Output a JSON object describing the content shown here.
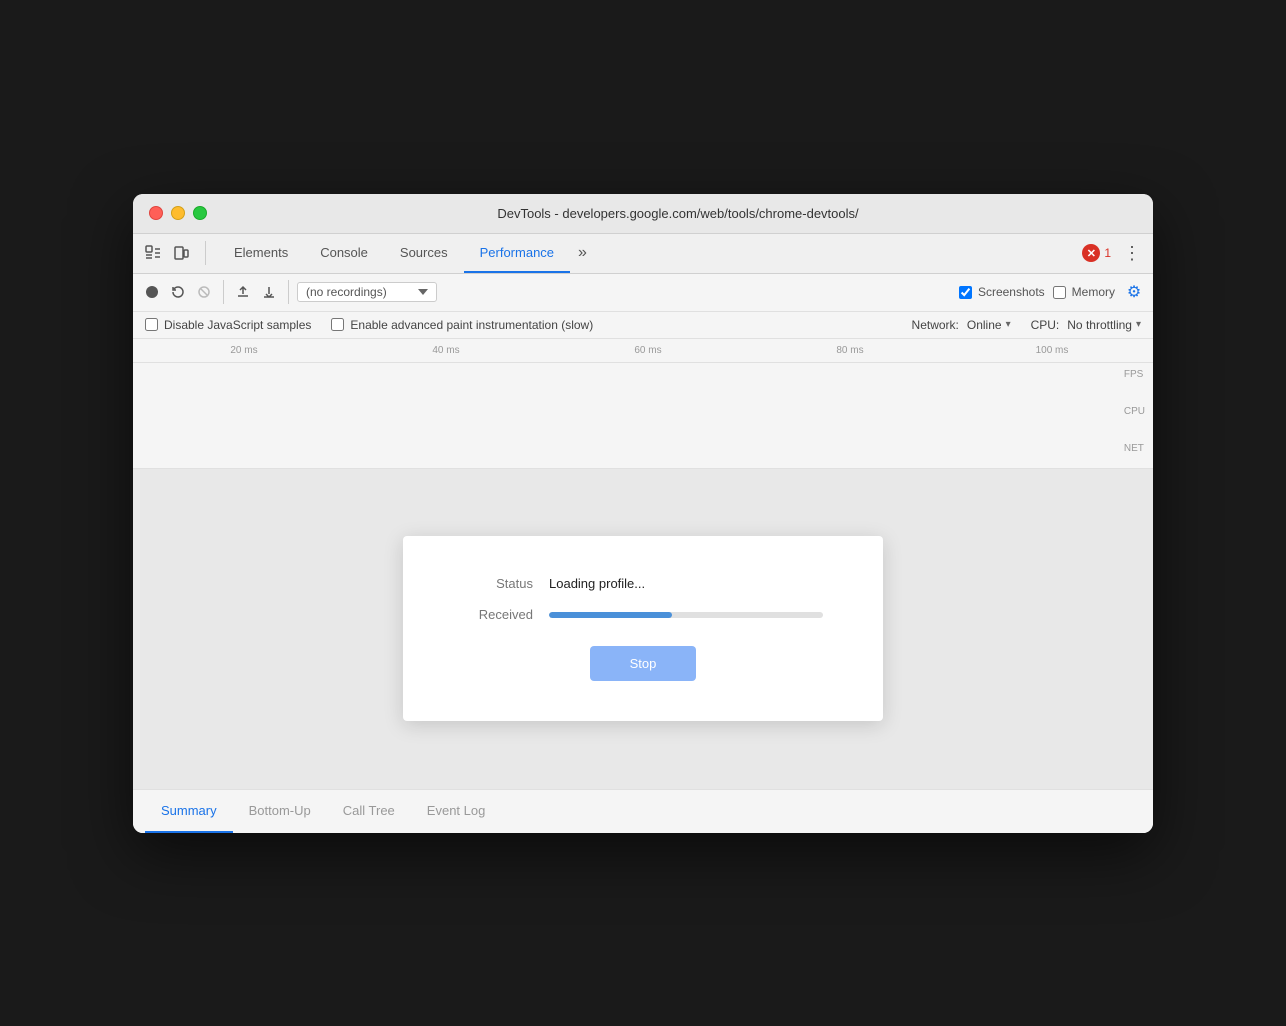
{
  "window": {
    "title": "DevTools - developers.google.com/web/tools/chrome-devtools/"
  },
  "traffic_lights": {
    "close_label": "close",
    "minimize_label": "minimize",
    "maximize_label": "maximize"
  },
  "tabs": {
    "items": [
      {
        "id": "elements",
        "label": "Elements"
      },
      {
        "id": "console",
        "label": "Console"
      },
      {
        "id": "sources",
        "label": "Sources"
      },
      {
        "id": "performance",
        "label": "Performance"
      }
    ],
    "active": "performance",
    "more_label": "»",
    "error_count": "1",
    "menu_label": "⋮"
  },
  "toolbar": {
    "record_tooltip": "Record",
    "reload_tooltip": "Reload",
    "clear_tooltip": "Clear",
    "upload_tooltip": "Load profile",
    "download_tooltip": "Save profile",
    "recordings_placeholder": "(no recordings)",
    "screenshots_label": "Screenshots",
    "memory_label": "Memory",
    "screenshots_checked": true,
    "memory_checked": false
  },
  "settings": {
    "disable_js_label": "Disable JavaScript samples",
    "advanced_paint_label": "Enable advanced paint instrumentation (slow)",
    "network_label": "Network:",
    "network_value": "Online",
    "cpu_label": "CPU:",
    "cpu_value": "No throttling"
  },
  "timeline": {
    "ruler_ticks": [
      "20 ms",
      "40 ms",
      "60 ms",
      "80 ms",
      "100 ms"
    ],
    "track_labels": [
      "FPS",
      "CPU",
      "NET"
    ]
  },
  "loading_dialog": {
    "status_label": "Status",
    "status_value": "Loading profile...",
    "received_label": "Received",
    "progress_percent": 45,
    "stop_label": "Stop"
  },
  "bottom_tabs": {
    "items": [
      {
        "id": "summary",
        "label": "Summary"
      },
      {
        "id": "bottom-up",
        "label": "Bottom-Up"
      },
      {
        "id": "call-tree",
        "label": "Call Tree"
      },
      {
        "id": "event-log",
        "label": "Event Log"
      }
    ],
    "active": "summary"
  }
}
